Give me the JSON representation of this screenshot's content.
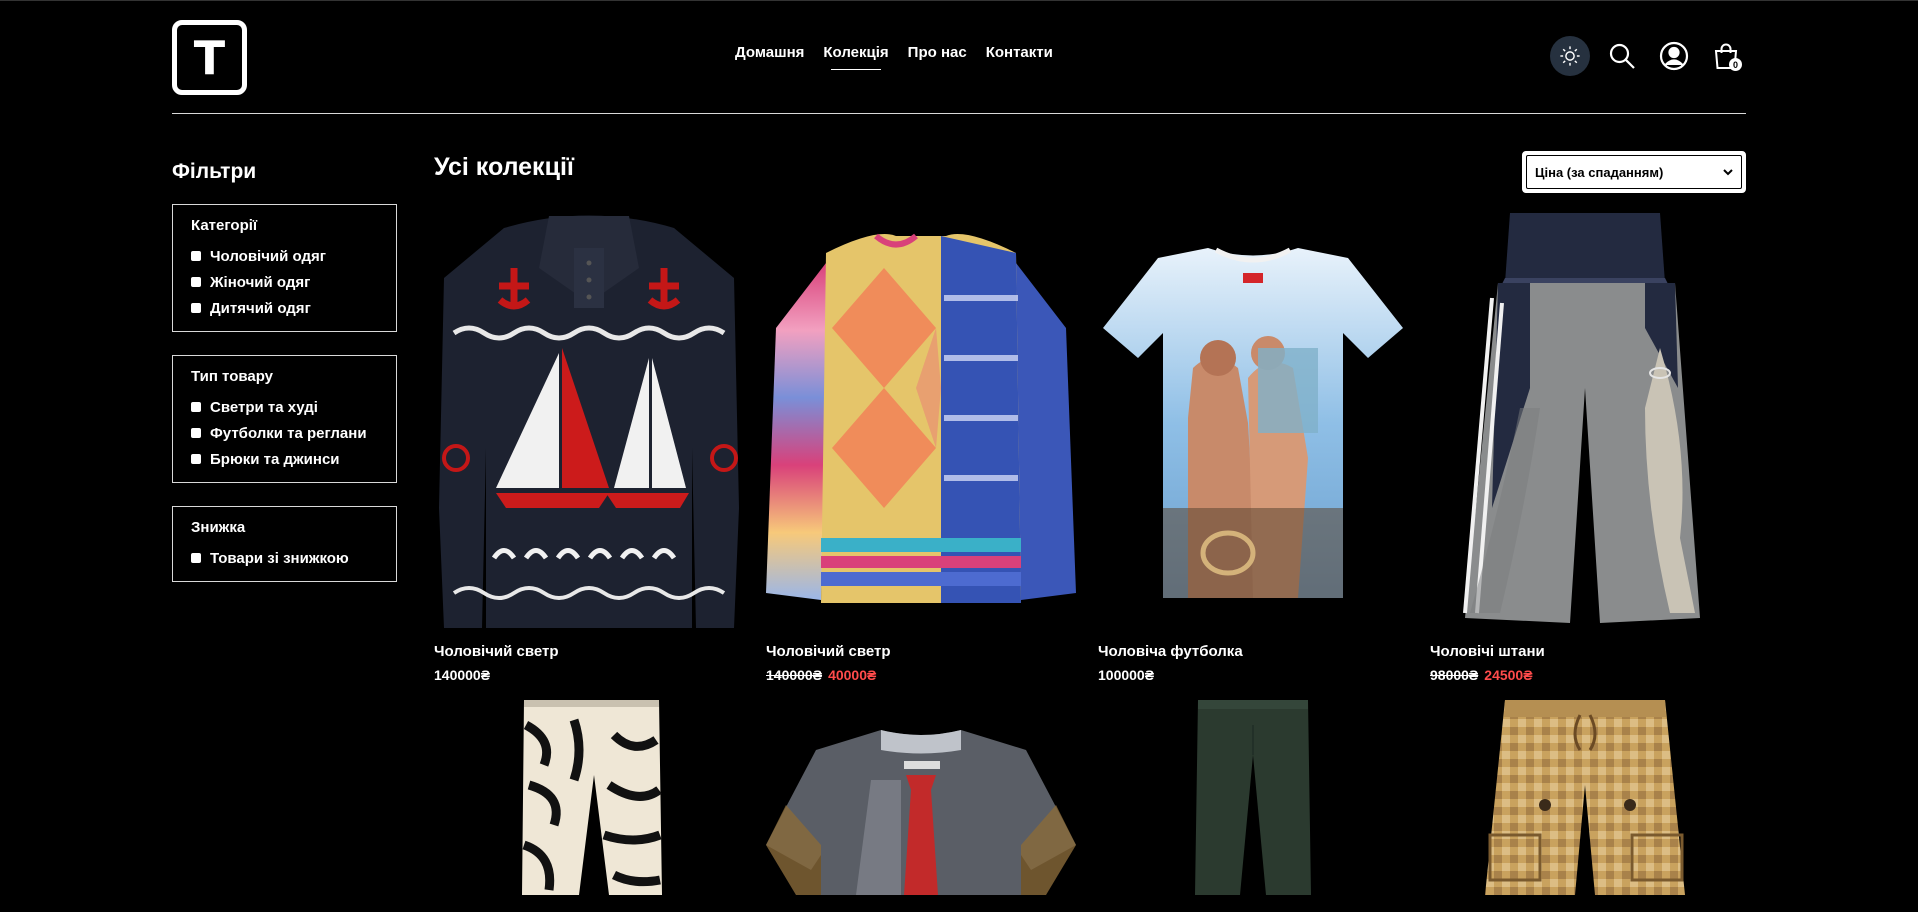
{
  "brand": {
    "logo_letter": "T"
  },
  "nav": [
    "Домашня",
    "Колекція",
    "Про нас",
    "Контакти"
  ],
  "nav_active": "Колекція",
  "header_icons": [
    "sun-icon",
    "search-icon",
    "user-icon",
    "cart-icon"
  ],
  "cart_count": "0",
  "filters": {
    "title": "Фільтри",
    "groups": [
      {
        "title": "Категорії",
        "options": [
          "Чоловічий одяг",
          "Жіночий одяг",
          "Дитячий одяг"
        ]
      },
      {
        "title": "Тип товару",
        "options": [
          "Светри та худі",
          "Футболки та реглани",
          "Брюки та джинси"
        ]
      },
      {
        "title": "Знижка",
        "options": [
          "Товари зі знижкою"
        ]
      }
    ]
  },
  "main": {
    "title": "Усі колекції",
    "sort_selected": "Ціна (за спаданням)"
  },
  "products": [
    {
      "name": "Чоловічий светр",
      "price": "140000₴",
      "old_price": "",
      "image": "navy knit sweater with red anchors and sailboats"
    },
    {
      "name": "Чоловічий светр",
      "price": "40000₴",
      "old_price": "140000₴",
      "image": "patchwork argyle and striped mohair sweater"
    },
    {
      "name": "Чоловіча футболка",
      "price": "100000₴",
      "old_price": "",
      "image": "white t-shirt with photo print"
    },
    {
      "name": "Чоловічі штани",
      "price": "24500₴",
      "old_price": "98000₴",
      "image": "grey wide track pants with white stripes"
    },
    {
      "name": "",
      "price": "",
      "old_price": "",
      "image": "zebra print trousers"
    },
    {
      "name": "",
      "price": "",
      "old_price": "",
      "image": "sheer t-shirt with printed shirt and tie"
    },
    {
      "name": "",
      "price": "",
      "old_price": "",
      "image": "dark green leggings"
    },
    {
      "name": "",
      "price": "",
      "old_price": "",
      "image": "beige checked cargo trousers"
    }
  ],
  "colors": {
    "background": "#000000",
    "text": "#ffffff",
    "sale": "#ff4b4b",
    "theme_button": "#26313f"
  }
}
